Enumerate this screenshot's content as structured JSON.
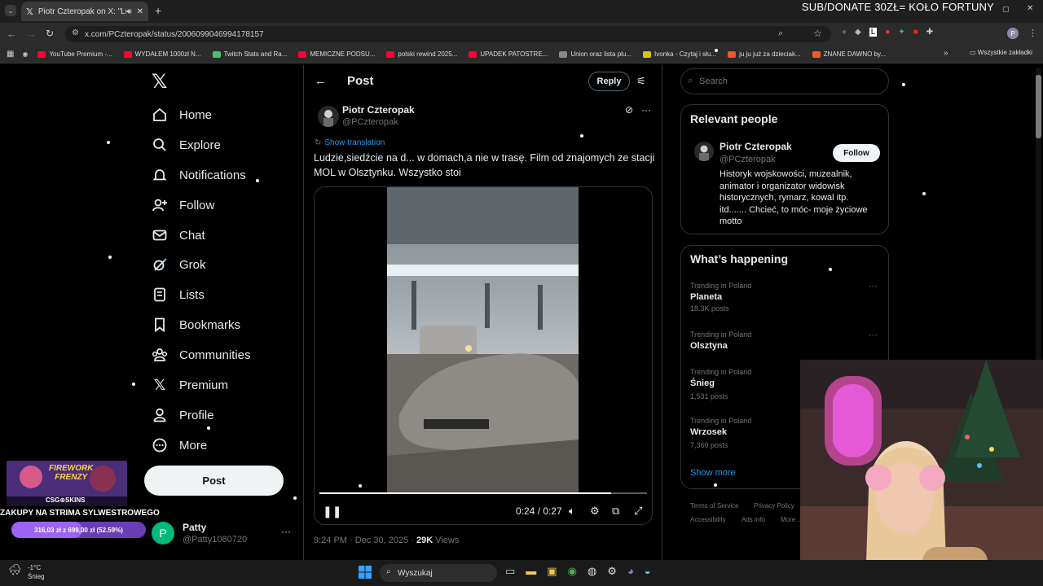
{
  "browser": {
    "tab_title": "Piotr Czteropak on X: \"Ludz",
    "url": "x.com/PCzteropak/status/2006099046994178157",
    "stream_banner": "SUB/DONATE 30ZŁ= KOŁO FORTUNY",
    "bookmarks": [
      {
        "label": "YouTube Premium -...",
        "color": "#ff0033"
      },
      {
        "label": "WYDAŁEM 1000zł N...",
        "color": "#ff0033"
      },
      {
        "label": "Twitch Stats and Ra...",
        "color": "#46c26e"
      },
      {
        "label": "MEMICZNE PODSU...",
        "color": "#ff0033"
      },
      {
        "label": "polski rewind 2025...",
        "color": "#ff0033"
      },
      {
        "label": "UPADEK PATOSTRE...",
        "color": "#ff0033"
      },
      {
        "label": "Union oraz lista plu...",
        "color": "#888888"
      },
      {
        "label": "Ivonka - Czytaj i słu...",
        "color": "#d7c21a"
      },
      {
        "label": "ju ju już za dzieciak...",
        "color": "#f05a28"
      },
      {
        "label": "ZNANE DAWNO by...",
        "color": "#f05a28"
      }
    ],
    "all_bookmarks": "Wszystkie zakładki"
  },
  "nav": {
    "items": [
      "Home",
      "Explore",
      "Notifications",
      "Follow",
      "Chat",
      "Grok",
      "Lists",
      "Bookmarks",
      "Communities",
      "Premium",
      "Profile",
      "More"
    ],
    "post_button": "Post",
    "account_name": "Patty",
    "account_handle": "@Patty1080720",
    "account_initial": "P"
  },
  "post": {
    "header_title": "Post",
    "reply_label": "Reply",
    "author_name": "Piotr Czteropak",
    "author_handle": "@PCzteropak",
    "show_translation": "Show translation",
    "text": "Ludzie,siedźcie na d... w domach,a nie w trasę. Film od znajomych ze stacji MOL w Olsztynku. Wszystko stoi",
    "time_label": "0:24 / 0:27",
    "progress": 0.89,
    "timestamp": "9:24 PM · Dec 30, 2025 · ",
    "views_count": "29K",
    "views_label": "Views"
  },
  "sidebar": {
    "search_placeholder": "Search",
    "relevant_title": "Relevant people",
    "person_name": "Piotr Czteropak",
    "person_handle": "@PCzteropak",
    "follow_label": "Follow",
    "person_bio": "Historyk wojskowości, muzealnik, animator i organizator widowisk historycznych, rymarz, kowal itp. itd....... Chcieć, to móc- moje życiowe motto",
    "happening_title": "What’s happening",
    "trends": [
      {
        "meta": "Trending in Poland",
        "name": "Planeta",
        "posts": "18.3K posts"
      },
      {
        "meta": "Trending in Poland",
        "name": "Olsztyna",
        "posts": ""
      },
      {
        "meta": "Trending in Poland",
        "name": "Śnieg",
        "posts": "1,531 posts"
      },
      {
        "meta": "Trending in Poland",
        "name": "Wrzosek",
        "posts": "7,360 posts"
      }
    ],
    "show_more": "Show more",
    "footer": [
      "Terms of Service",
      "Privacy Policy",
      "Accessibility",
      "Ads info",
      "More ..."
    ]
  },
  "overlay": {
    "game_title_1": "FIREWORK",
    "game_title_2": "FRENZY",
    "game_brand": "CSG⊕SKINS",
    "donation_title": "ZAKUPY NA STRIMA SYLWESTROWEGO",
    "donation_goal": "316,03 zł z 699,00 zł (52.59%)",
    "donation_progress": 0.5259
  },
  "taskbar": {
    "weather_temp": "-1°C",
    "weather_desc": "Śnieg",
    "search_label": "Wyszukaj"
  },
  "colors": {
    "accent": "#1d9bf0",
    "background": "#000000",
    "avatar_green": "#00ba7c"
  }
}
